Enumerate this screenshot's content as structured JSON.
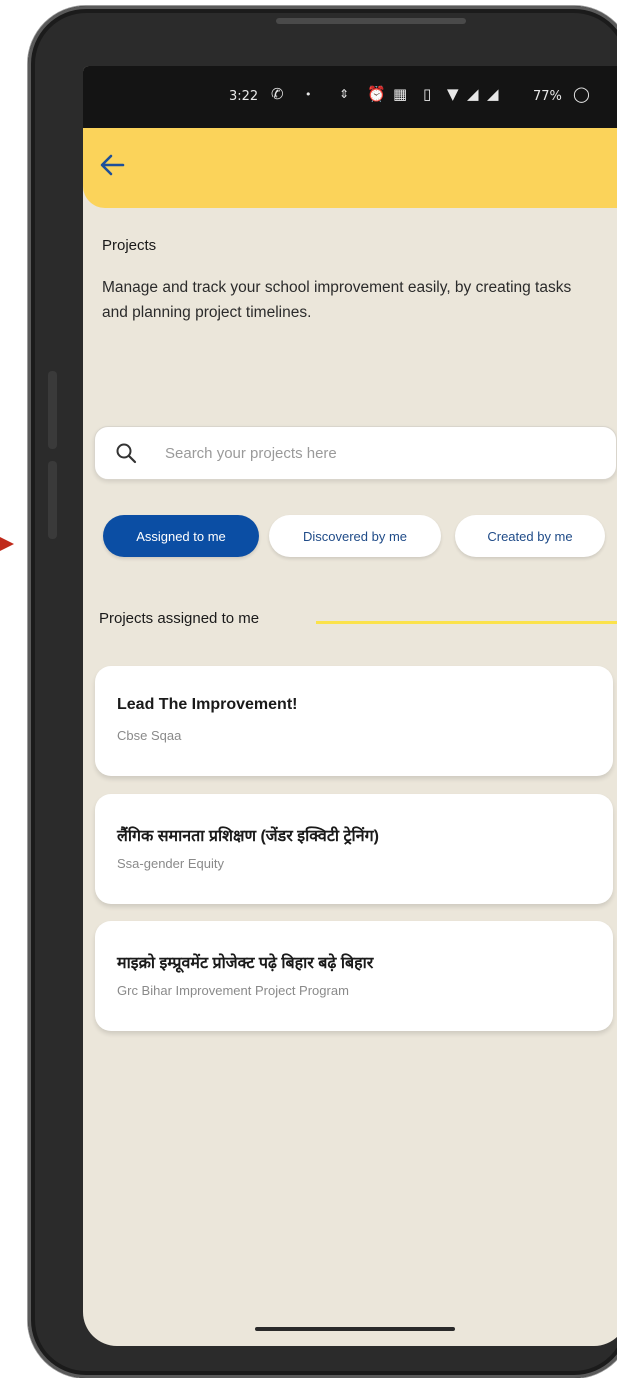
{
  "status_bar": {
    "time": "3:22",
    "battery": "77%",
    "icons": [
      "whatsapp-icon",
      "dot-icon",
      "data-speed-icon",
      "alarm-icon",
      "hd-icon",
      "vibrate-icon",
      "wifi-icon",
      "signal-icon",
      "signal-icon-2",
      "battery-saver-icon"
    ]
  },
  "app_bar": {
    "back_icon": "arrow-left-icon",
    "accent_color": "#fbd35a"
  },
  "header": {
    "title": "Projects",
    "description": "Manage and track your school improvement easily, by creating tasks and planning project timelines."
  },
  "search": {
    "placeholder": "Search your projects here",
    "value": ""
  },
  "tabs": [
    {
      "label": "Assigned to me",
      "active": true
    },
    {
      "label": "Discovered by me",
      "active": false
    },
    {
      "label": "Created by me",
      "active": false
    }
  ],
  "section": {
    "heading": "Projects assigned to me"
  },
  "projects": [
    {
      "title": "Lead The Improvement!",
      "subtitle": "Cbse Sqaa"
    },
    {
      "title": "लैंगिक समानता प्रशिक्षण (जेंडर इक्विटी ट्रेनिंग)",
      "subtitle": "Ssa-gender Equity"
    },
    {
      "title": "माइक्रो इम्प्रूवमेंट प्रोजेक्ट पढ़े बिहार बढ़े बिहार",
      "subtitle": "Grc Bihar Improvement Project Program"
    }
  ],
  "colors": {
    "primary": "#0b4ea4",
    "background": "#ebe6da",
    "section_line": "#fbe24a"
  }
}
